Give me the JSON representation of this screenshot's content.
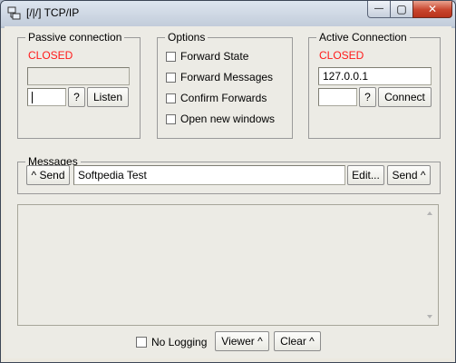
{
  "window": {
    "title": "[/|/] TCP/IP",
    "minimize_glyph": "—",
    "maximize_glyph": "▢",
    "close_glyph": "✕"
  },
  "passive": {
    "label": "Passive connection",
    "status": "CLOSED",
    "address_value": "",
    "port_value": "",
    "help_label": "?",
    "listen_label": "Listen"
  },
  "options": {
    "label": "Options",
    "items": [
      {
        "label": "Forward State",
        "checked": false
      },
      {
        "label": "Forward Messages",
        "checked": false
      },
      {
        "label": "Confirm Forwards",
        "checked": false
      },
      {
        "label": "Open new windows",
        "checked": false
      }
    ]
  },
  "active": {
    "label": "Active Connection",
    "status": "CLOSED",
    "host_value": "127.0.0.1",
    "port_value": "",
    "help_label": "?",
    "connect_label": "Connect"
  },
  "messages": {
    "label": "Messages",
    "send_left_label": "^ Send",
    "message_value": "Softpedia Test",
    "edit_label": "Edit...",
    "send_right_label": "Send ^",
    "log_text": ""
  },
  "footer": {
    "no_logging_label": "No Logging",
    "no_logging_checked": false,
    "viewer_label": "Viewer ^",
    "clear_label": "Clear ^"
  },
  "colors": {
    "status_closed": "#ff1a1a",
    "window_bg": "#ecebe5"
  }
}
